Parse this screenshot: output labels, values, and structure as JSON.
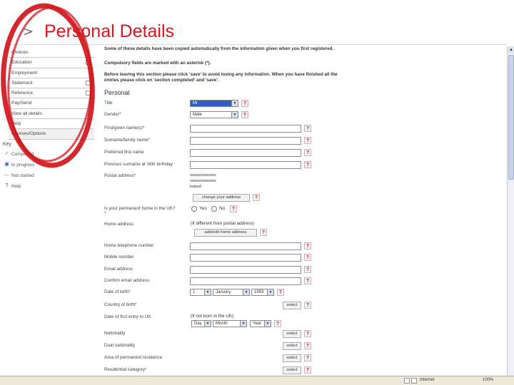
{
  "slide": {
    "chevron": ">",
    "title": "Personal Details"
  },
  "nav": {
    "items": [
      {
        "label": "Choices",
        "box": false
      },
      {
        "label": "Education",
        "box": true
      },
      {
        "label": "Employment",
        "box": false
      },
      {
        "label": "Statement",
        "box": true
      },
      {
        "label": "Reference",
        "box": true
      },
      {
        "label": "Pay/Send",
        "box": false
      },
      {
        "label": "View all details",
        "box": false
      },
      {
        "label": "Help",
        "box": false
      },
      {
        "label": "Courses/Options",
        "box": false
      }
    ],
    "key_label": "Key",
    "key_items": [
      {
        "mark": "✓",
        "label": "Completed"
      },
      {
        "mark": "▣",
        "label": "In progress"
      },
      {
        "mark": "—",
        "label": "Not started"
      },
      {
        "mark": "?",
        "label": "Help"
      }
    ]
  },
  "intro": {
    "p1": "Some of these details have been copied automatically from the information given when you first registered.",
    "p2": "Compulsory fields are marked with an asterisk (*).",
    "p3": "Before leaving this section please click 'save' to avoid losing any information. When you have finished all the entries please click on 'section completed' and 'save'."
  },
  "section_heading": "Personal",
  "help_glyph": "?",
  "fields": {
    "title": {
      "label": "Title",
      "value": "Mr"
    },
    "gender": {
      "label": "Gender*",
      "value": "Male"
    },
    "first_names": {
      "label": "First/given name(s)*"
    },
    "surname": {
      "label": "Surname/family name*"
    },
    "preferred": {
      "label": "Preferred first name"
    },
    "previous_surname": {
      "label": "Previous surname at 16th birthday"
    },
    "postal": {
      "label": "Postal address*",
      "lines": [
        "xxxxxxxxxxxxxx",
        "xxxxxxxxxxxxxx",
        "Ireland"
      ],
      "button": "change your address"
    },
    "permanent_home": {
      "label": "Is your permanent home in the UK?",
      "star": "*",
      "yes": "Yes",
      "no": "No"
    },
    "home_address": {
      "label": "Home address",
      "note": "(If different from postal address)",
      "button": "add/edit home address"
    },
    "home_phone": {
      "label": "Home telephone number"
    },
    "mobile": {
      "label": "Mobile number"
    },
    "email": {
      "label": "Email address"
    },
    "confirm_email": {
      "label": "Confirm email address"
    },
    "dob": {
      "label": "Date of birth*",
      "day": "1",
      "month": "January",
      "year": "1993"
    },
    "country_birth": {
      "label": "Country of birth*",
      "button": "select"
    },
    "first_entry": {
      "label": "Date of first entry to UK",
      "note": "(If not born in the UK)",
      "day": "Day",
      "month": "Month",
      "year": "Year"
    },
    "nationality": {
      "label": "Nationality",
      "button": "select"
    },
    "dual_nationality": {
      "label": "Dual nationality",
      "button": "select"
    },
    "permanent_residence": {
      "label": "Area of permanent residence",
      "button": "select"
    },
    "residential_category": {
      "label": "Residential category*",
      "button": "select"
    }
  },
  "status": {
    "zone": "Internet",
    "zoom": "100%"
  },
  "colors": {
    "accent": "#e0141e",
    "annotation": "#d0161c",
    "selected_field": "#2f5fc4"
  }
}
